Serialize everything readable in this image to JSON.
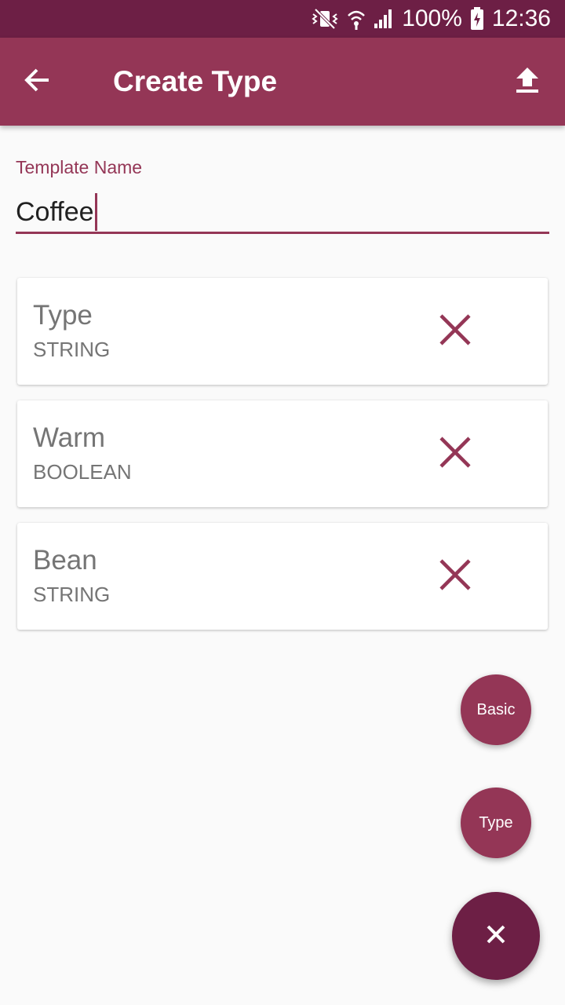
{
  "status_bar": {
    "battery": "100%",
    "time": "12:36",
    "icons": [
      "vibrate-icon",
      "wifi-icon",
      "signal-icon",
      "battery-charging-icon"
    ]
  },
  "app_bar": {
    "title": "Create Type",
    "back_icon": "arrow-back-icon",
    "upload_icon": "upload-icon"
  },
  "template_name": {
    "label": "Template Name",
    "value": "Coffee"
  },
  "fields": [
    {
      "name": "Type",
      "type": "STRING"
    },
    {
      "name": "Warm",
      "type": "BOOLEAN"
    },
    {
      "name": "Bean",
      "type": "STRING"
    }
  ],
  "fab": {
    "basic_label": "Basic",
    "type_label": "Type",
    "close_icon": "close-icon"
  },
  "colors": {
    "primary": "#943656",
    "primary_dark": "#6d1f45",
    "background": "#fafafa"
  }
}
